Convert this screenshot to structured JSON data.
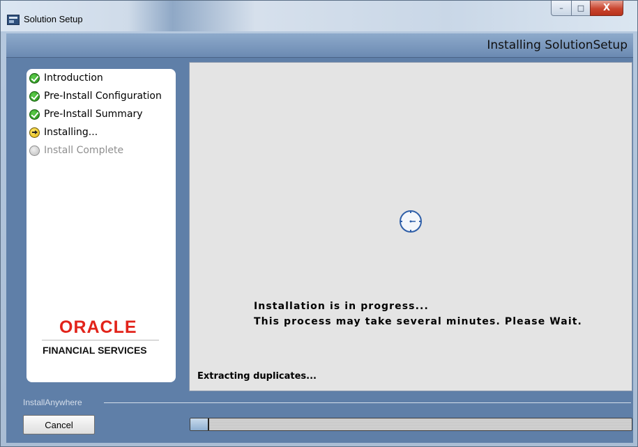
{
  "window": {
    "title": "Solution Setup",
    "minimize_label": "–",
    "maximize_label": "□",
    "close_label": "X"
  },
  "header": {
    "title": "Installing SolutionSetup"
  },
  "steps": [
    {
      "label": "Introduction",
      "state": "done",
      "icon": "check-icon"
    },
    {
      "label": "Pre-Install Configuration",
      "state": "done",
      "icon": "check-icon"
    },
    {
      "label": "Pre-Install Summary",
      "state": "done",
      "icon": "check-icon"
    },
    {
      "label": "Installing...",
      "state": "current",
      "icon": "arrow-icon"
    },
    {
      "label": "Install Complete",
      "state": "pending",
      "icon": "pending-icon"
    }
  ],
  "logo": {
    "brand": "ORACLE",
    "subtitle": "FINANCIAL SERVICES"
  },
  "content": {
    "message_line1": "Installation is in progress...",
    "message_line2": "This process may take several minutes. Please Wait.",
    "status": "Extracting duplicates...",
    "busy_icon": "clock-icon"
  },
  "footer": {
    "vendor_label": "InstallAnywhere",
    "cancel_label": "Cancel",
    "progress_fraction": 0.04
  },
  "colors": {
    "oracle_red": "#e2231a",
    "header_blue": "#6b8ab2",
    "client_blue": "#5f7fa8"
  }
}
